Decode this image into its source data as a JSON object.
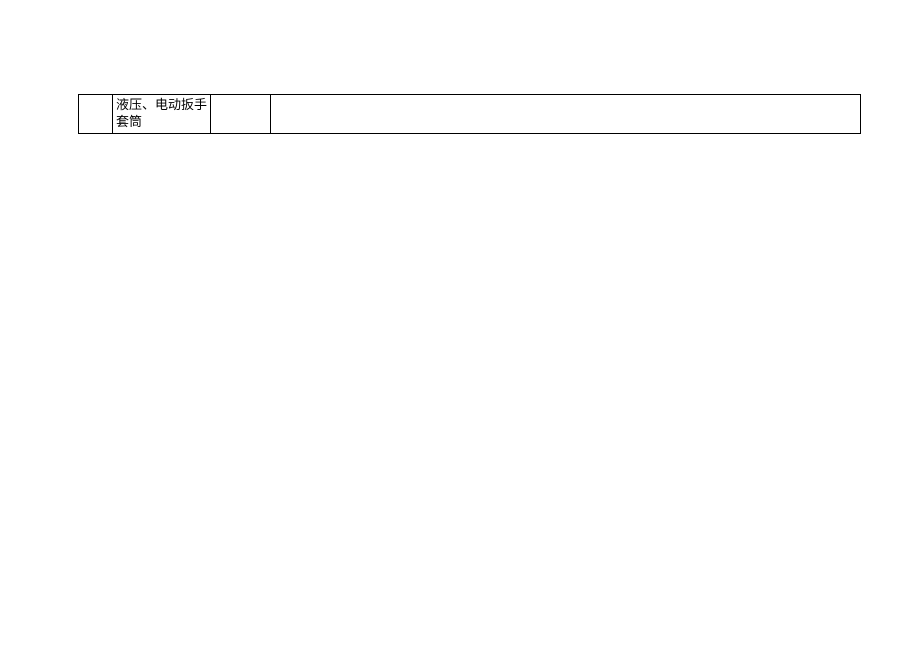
{
  "table": {
    "rows": [
      {
        "col1": "",
        "col2": "液压、电动扳手套筒",
        "col3": "",
        "col4": ""
      }
    ]
  }
}
